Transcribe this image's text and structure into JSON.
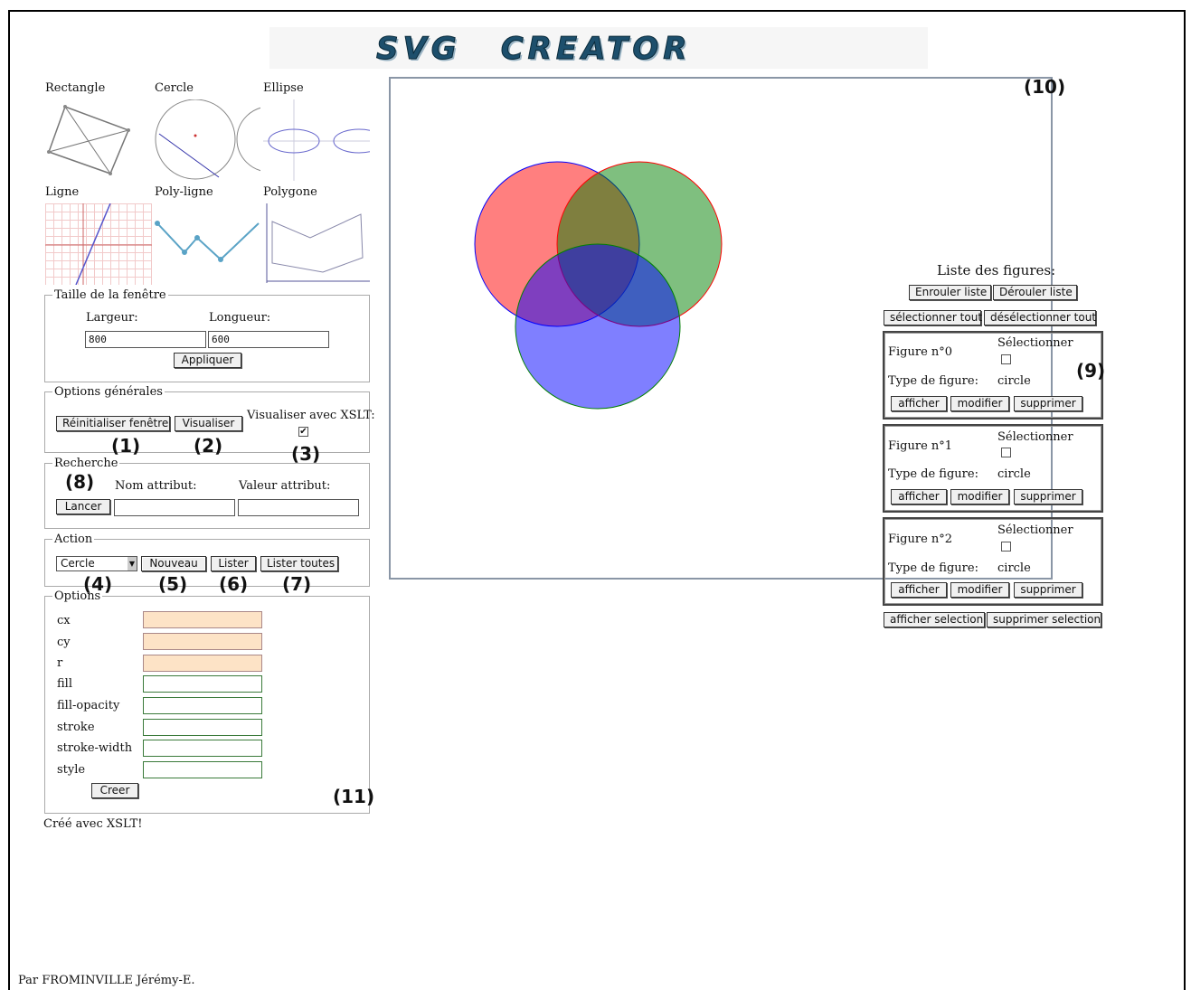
{
  "banner": {
    "word1": "SVG",
    "word2": "CREATOR"
  },
  "shapes": [
    {
      "label": "Rectangle"
    },
    {
      "label": "Cercle"
    },
    {
      "label": "Ellipse"
    },
    {
      "label": "Ligne"
    },
    {
      "label": "Poly-ligne"
    },
    {
      "label": "Polygone"
    }
  ],
  "window_size": {
    "legend": "Taille de la fenêtre",
    "width_label": "Largeur:",
    "height_label": "Longueur:",
    "width_value": "800",
    "height_value": "600",
    "apply": "Appliquer"
  },
  "general": {
    "legend": "Options générales",
    "reset": "Réinitialiser fenêtre",
    "view": "Visualiser",
    "xslt_label": "Visualiser avec XSLT:",
    "xslt_checked": "✔"
  },
  "search": {
    "legend": "Recherche",
    "launch": "Lancer",
    "attr_name": "Nom attribut:",
    "attr_value": "Valeur attribut:"
  },
  "action": {
    "legend": "Action",
    "select_value": "Cercle",
    "new": "Nouveau",
    "list": "Lister",
    "list_all": "Lister toutes"
  },
  "options": {
    "legend": "Options",
    "fields": [
      {
        "name": "cx"
      },
      {
        "name": "cy"
      },
      {
        "name": "r"
      },
      {
        "name": "fill"
      },
      {
        "name": "fill-opacity"
      },
      {
        "name": "stroke"
      },
      {
        "name": "stroke-width"
      },
      {
        "name": "style"
      }
    ],
    "create": "Creer"
  },
  "xslt_note": "Créé avec XSLT!",
  "footer": "Par FROMINVILLE Jérémy-E.",
  "figures_panel": {
    "title": "Liste des figures:",
    "collapse": "Enrouler liste",
    "expand": "Dérouler liste",
    "select_all": "sélectionner tout",
    "deselect_all": "désélectionner tout",
    "show_selection": "afficher selection",
    "delete_selection": "supprimer selection",
    "select_label": "Sélectionner",
    "type_label": "Type de figure:",
    "show": "afficher",
    "edit": "modifier",
    "delete": "supprimer",
    "items": [
      {
        "title": "Figure n°0",
        "type": "circle"
      },
      {
        "title": "Figure n°1",
        "type": "circle"
      },
      {
        "title": "Figure n°2",
        "type": "circle"
      }
    ]
  },
  "annotations": {
    "a1": "(1)",
    "a2": "(2)",
    "a3": "(3)",
    "a4": "(4)",
    "a5": "(5)",
    "a6": "(6)",
    "a7": "(7)",
    "a8": "(8)",
    "a9": "(9)",
    "a10": "(10)",
    "a11": "(11)"
  },
  "colors": {
    "circle0_fill": "#ff0000",
    "circle1_fill": "#008000",
    "circle2_fill": "#0000ff"
  }
}
